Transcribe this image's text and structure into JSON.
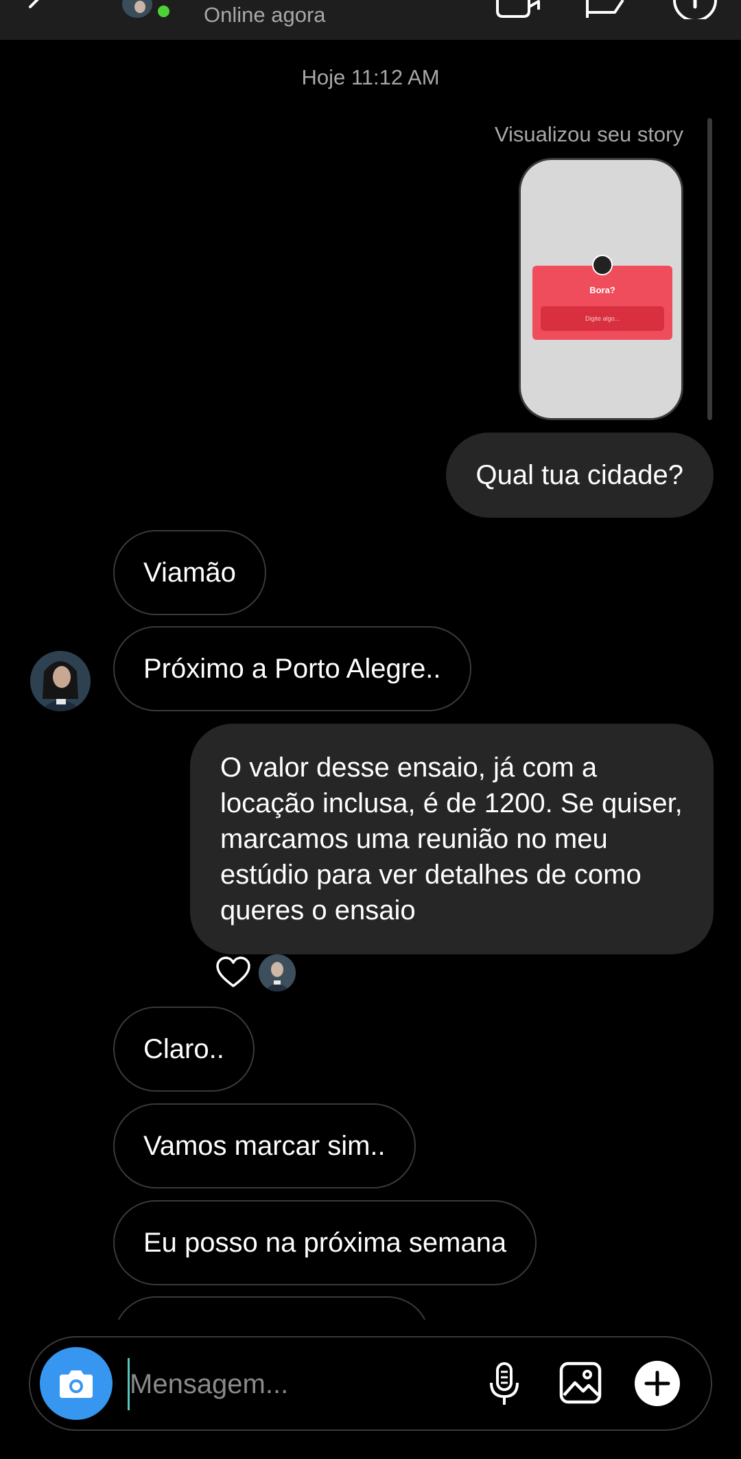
{
  "header": {
    "status": "Online agora"
  },
  "conversation": {
    "timestamp": "Hoje 11:12 AM",
    "story_reply": {
      "caption": "Visualizou seu story",
      "preview_title": "Bora?",
      "preview_input_placeholder": "Digite algo..."
    },
    "messages": [
      {
        "from": "me",
        "text": "Qual tua cidade?"
      },
      {
        "from": "them",
        "text": "Viamão"
      },
      {
        "from": "them",
        "text": "Próximo a Porto Alegre.."
      },
      {
        "from": "me",
        "text": "O valor desse ensaio, já com a locação inclusa, é de 1200. Se quiser, marcamos uma reunião no meu estúdio para ver detalhes de como queres o ensaio"
      },
      {
        "from": "them",
        "text": "Claro.."
      },
      {
        "from": "them",
        "text": "Vamos marcar sim.."
      },
      {
        "from": "them",
        "text": "Eu posso na próxima semana"
      }
    ],
    "reaction": "heart"
  },
  "composer": {
    "placeholder": "Mensagem...",
    "icons": [
      "camera-icon",
      "microphone-icon",
      "gallery-icon",
      "plus-icon"
    ]
  },
  "colors": {
    "background": "#000000",
    "sent_bubble": "#262626",
    "received_border": "#3a3a3a",
    "online": "#4cd137",
    "camera_button": "#3797f0"
  }
}
